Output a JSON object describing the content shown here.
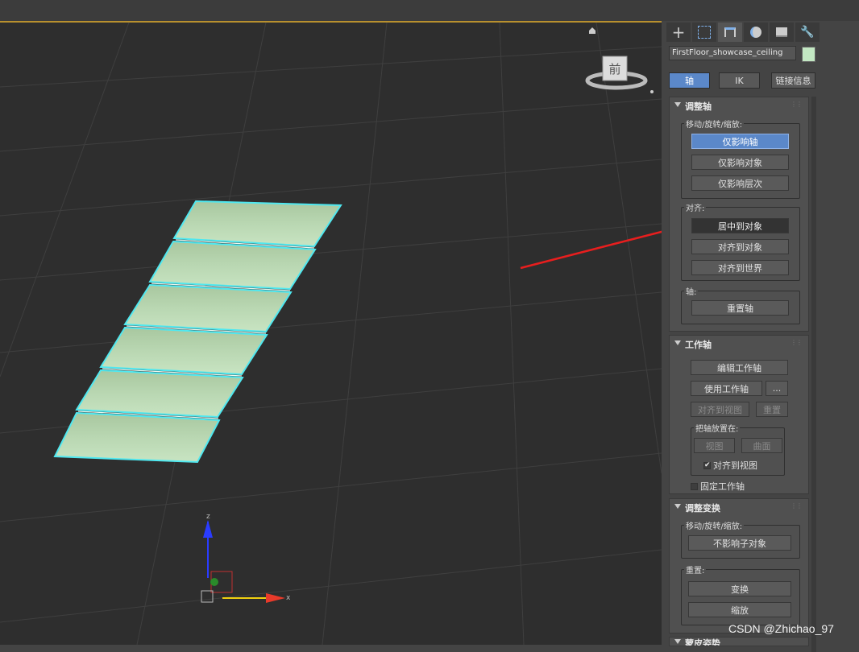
{
  "toolbar": {
    "tabs": [
      {
        "icon": "plus-icon",
        "name": "create"
      },
      {
        "icon": "curve-icon",
        "name": "modify"
      },
      {
        "icon": "hierarchy-icon",
        "name": "hierarchy"
      },
      {
        "icon": "sphere-icon",
        "name": "motion"
      },
      {
        "icon": "monitor-icon",
        "name": "display"
      },
      {
        "icon": "wrench-icon",
        "name": "utilities"
      }
    ]
  },
  "object": {
    "name": "FirstFloor_showcase_ceiling",
    "color": "#c3e8c3"
  },
  "hierarchy_tabs": {
    "pivot": "轴",
    "ik": "IK",
    "link_info": "链接信息"
  },
  "adjust_pivot": {
    "title": "调整轴",
    "move_rotate_scale_label": "移动/旋转/缩放:",
    "affect_pivot_only": "仅影响轴",
    "affect_object_only": "仅影响对象",
    "affect_hierarchy_only": "仅影响层次",
    "alignment_label": "对齐:",
    "center_to_object": "居中到对象",
    "align_to_object": "对齐到对象",
    "align_to_world": "对齐到世界",
    "pivot_label": "轴:",
    "reset_pivot": "重置轴"
  },
  "working_pivot": {
    "title": "工作轴",
    "edit_working_pivot": "编辑工作轴",
    "use_working_pivot": "使用工作轴",
    "ellipsis": "...",
    "align_to_view": "对齐到视图",
    "reset": "重置",
    "place_pivot_label": "把轴放置在:",
    "view": "视图",
    "surface": "曲面",
    "align_to_view_check": "对齐到视图",
    "lock_working_pivot": "固定工作轴"
  },
  "adjust_transform": {
    "title": "调整变换",
    "move_rotate_scale_label": "移动/旋转/缩放:",
    "dont_affect_children": "不影响子对象",
    "reset_label": "重置:",
    "transform": "变换",
    "scale": "缩放"
  },
  "skin_pose": {
    "title": "蒙皮姿势"
  },
  "viewcube": {
    "face": "前"
  },
  "gizmo": {
    "x": "x",
    "z": "z"
  },
  "watermark": "CSDN @Zhichao_97",
  "colors": {
    "accent": "#5b88c9",
    "selection": "#4fe8f0",
    "object_fill": "#b9d7b2",
    "arrow": "#e81e1e"
  }
}
